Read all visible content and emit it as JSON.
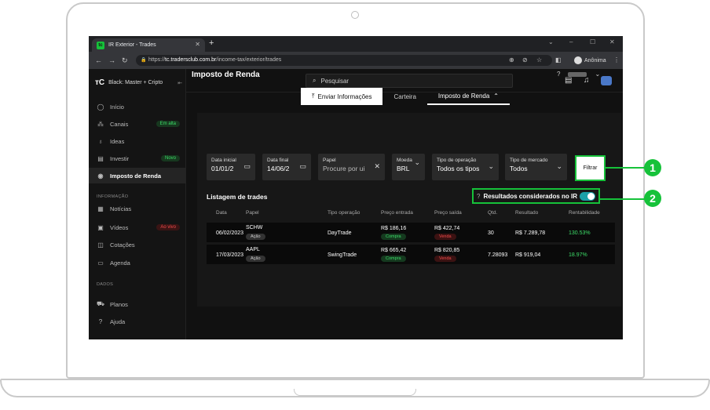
{
  "browser": {
    "tab_title": "IR Exterior - Trades",
    "url_prefix": "https://",
    "url_domain": "tc.tradersclub.com.br",
    "url_path": "/income-tax/exterior/trades",
    "profile_label": "Anônima"
  },
  "sidebar": {
    "brand": "Black: Master + Cripto",
    "items": [
      {
        "label": "Início"
      },
      {
        "label": "Canais",
        "badge": "Em alta"
      },
      {
        "label": "Ideas"
      },
      {
        "label": "Investir",
        "badge": "Novo"
      },
      {
        "label": "Imposto de Renda"
      }
    ],
    "section_info": "INFORMAÇÃO",
    "info_items": [
      {
        "label": "Notícias"
      },
      {
        "label": "Vídeos",
        "badge": "Ao vivo"
      },
      {
        "label": "Cotações"
      },
      {
        "label": "Agenda"
      }
    ],
    "section_data": "DADOS",
    "data_items": [
      {
        "label": "Planos"
      },
      {
        "label": "Ajuda"
      }
    ]
  },
  "topbar": {
    "search_placeholder": "Pesquisar"
  },
  "page": {
    "title": "Imposto de Renda",
    "tabs": [
      "Enviar Informações",
      "Carteira",
      "Imposto de Renda"
    ]
  },
  "filters": {
    "start_date": {
      "label": "Data inicial",
      "value": "01/01/2"
    },
    "end_date": {
      "label": "Data final",
      "value": "14/06/2"
    },
    "asset": {
      "label": "Papel",
      "placeholder": "Procure por ui"
    },
    "currency": {
      "label": "Moeda",
      "value": "BRL"
    },
    "operation_type": {
      "label": "Tipo de operação",
      "value": "Todos os tipos"
    },
    "market_type": {
      "label": "Tipo de mercado",
      "value": "Todos"
    },
    "filter_button": "Filtrar"
  },
  "list": {
    "title": "Listagem de trades",
    "ir_toggle_label": "Resultados considerados no IR",
    "ir_toggle_on": true,
    "headers": [
      "Data",
      "Papel",
      "Tipo operação",
      "Preço entrada",
      "Preço saída",
      "Qtd.",
      "Resultado",
      "Rentabilidade"
    ],
    "rows": [
      {
        "date": "06/02/2023",
        "ticker": "SCHW",
        "asset_type": "Ação",
        "op_type": "DayTrade",
        "entry": "R$ 186,16",
        "entry_tag": "Compra",
        "exit": "R$ 422,74",
        "exit_tag": "Venda",
        "qty": "30",
        "result": "R$ 7.289,78",
        "return": "130.53%"
      },
      {
        "date": "17/03/2023",
        "ticker": "AAPL",
        "asset_type": "Ação",
        "op_type": "SwingTrade",
        "entry": "R$ 665,42",
        "entry_tag": "Compra",
        "exit": "R$ 820,85",
        "exit_tag": "Venda",
        "qty": "7.28093",
        "result": "R$ 919,04",
        "return": "18.97%"
      }
    ]
  },
  "callouts": [
    "1",
    "2"
  ],
  "colors": {
    "accent": "#16c23a",
    "toggle": "#1aa0a8",
    "negative": "#ef4b4b"
  }
}
